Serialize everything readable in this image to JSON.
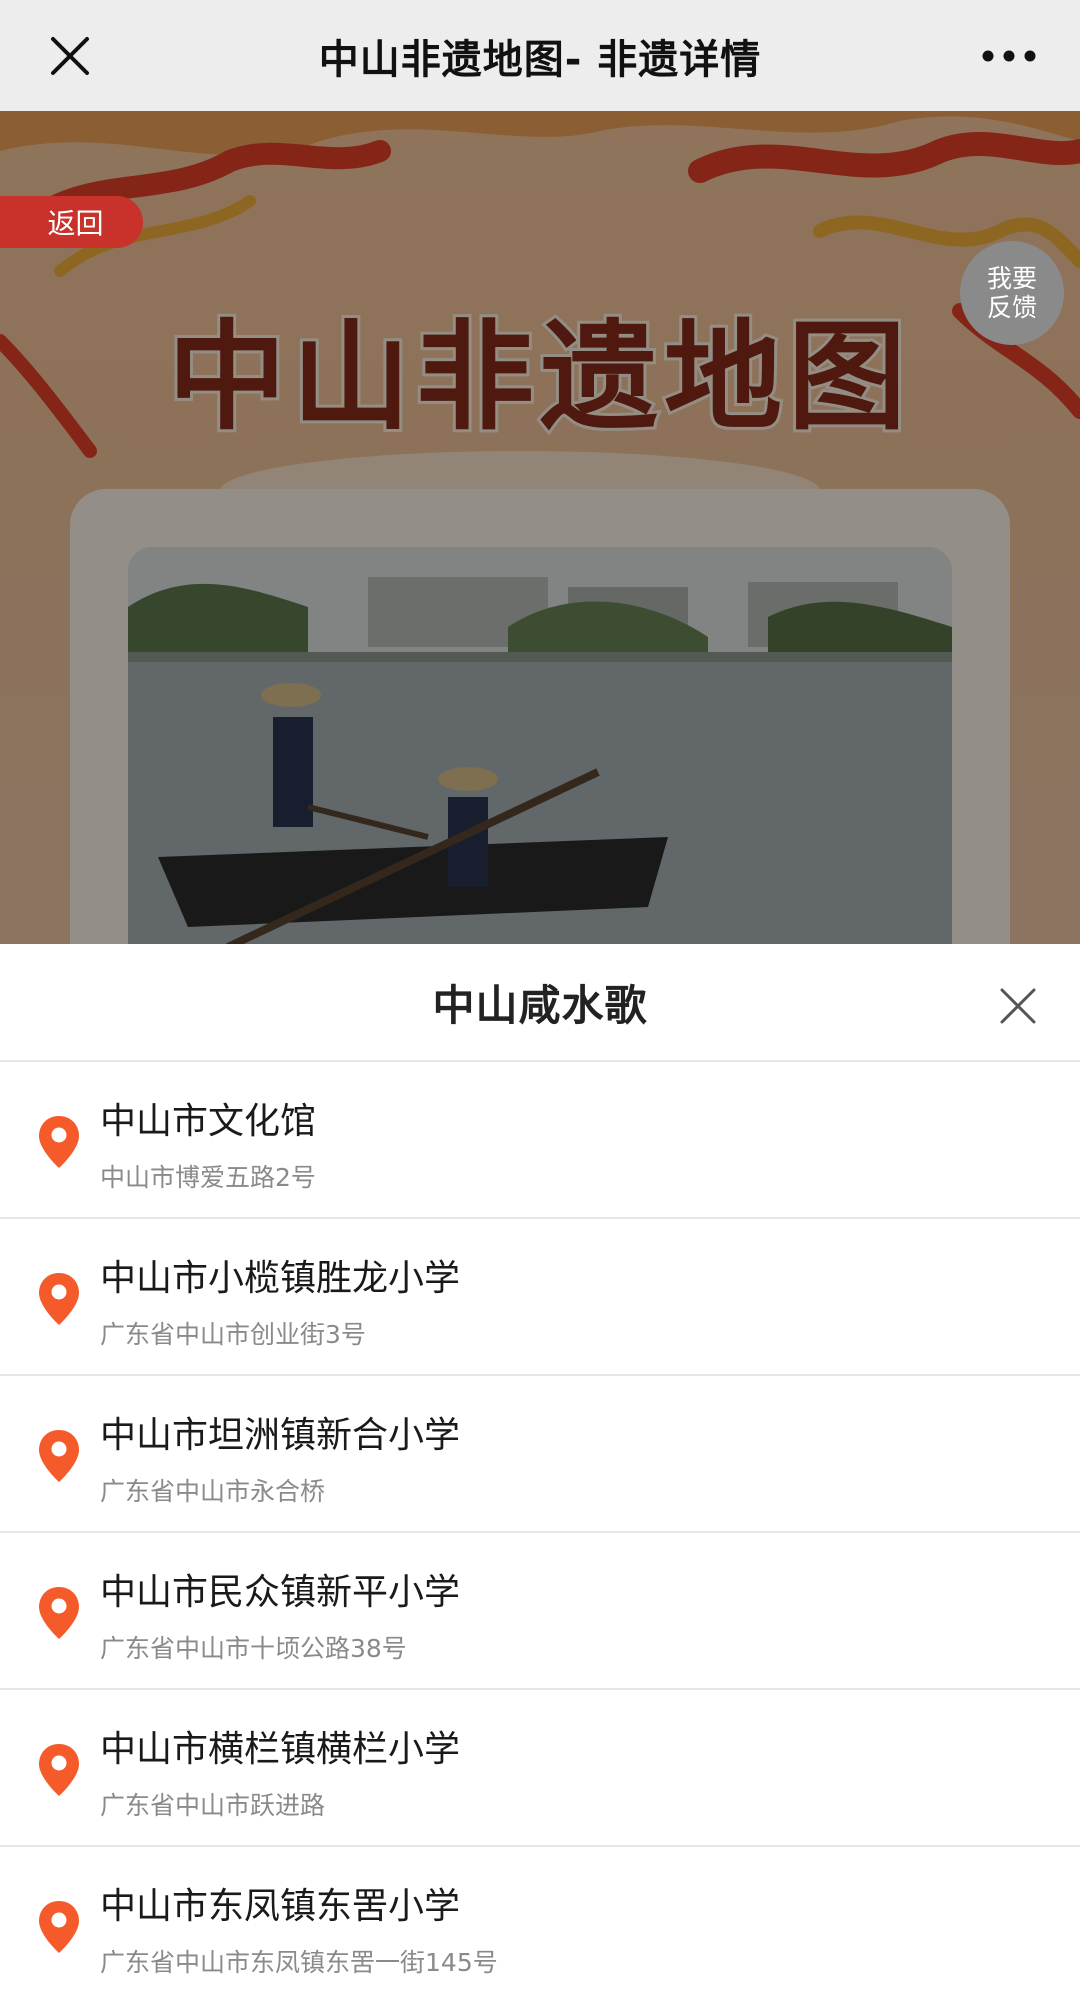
{
  "window": {
    "title": "中山非遗地图- 非遗详情",
    "close_icon": "close-icon",
    "more_icon": "more-horizontal-icon"
  },
  "background_page": {
    "back_label": "返回",
    "feedback_line1": "我要",
    "feedback_line2": "反馈",
    "banner_title": "中山非遗地图",
    "photo_icon": "photo-image"
  },
  "sheet": {
    "title": "中山咸水歌",
    "close_icon": "close-icon",
    "locations": [
      {
        "name": "中山市文化馆",
        "address": "中山市博爱五路2号"
      },
      {
        "name": "中山市小榄镇胜龙小学",
        "address": "广东省中山市创业街3号"
      },
      {
        "name": "中山市坦洲镇新合小学",
        "address": "广东省中山市永合桥"
      },
      {
        "name": "中山市民众镇新平小学",
        "address": "广东省中山市十顷公路38号"
      },
      {
        "name": "中山市横栏镇横栏小学",
        "address": "广东省中山市跃进路"
      },
      {
        "name": "中山市东凤镇东罟小学",
        "address": "广东省中山市东凤镇东罟一街145号"
      }
    ]
  },
  "colors": {
    "pin": "#f45a2a",
    "back_pill": "#c8322a",
    "banner_text": "#8a2c1c"
  }
}
